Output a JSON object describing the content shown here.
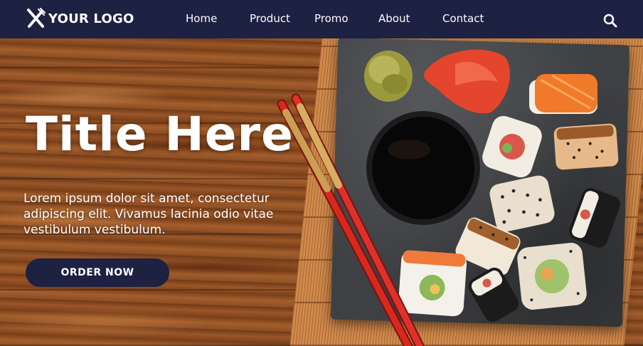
{
  "nav": {
    "logo_text": "YOUR LOGO",
    "links": [
      "Home",
      "Product",
      "Promo",
      "About",
      "Contact"
    ]
  },
  "hero": {
    "title": "Title Here",
    "body": "Lorem ipsum dolor sit amet, consectetur adipiscing elit. Vivamus lacinia odio vitae vestibulum vestibulum.",
    "cta_label": "ORDER NOW"
  },
  "colors": {
    "nav_bg": "#1d2142",
    "cta_bg": "#1d2142",
    "text": "#ffffff"
  },
  "icons": {
    "logo": "fork-knife-icon",
    "search": "search-icon"
  }
}
